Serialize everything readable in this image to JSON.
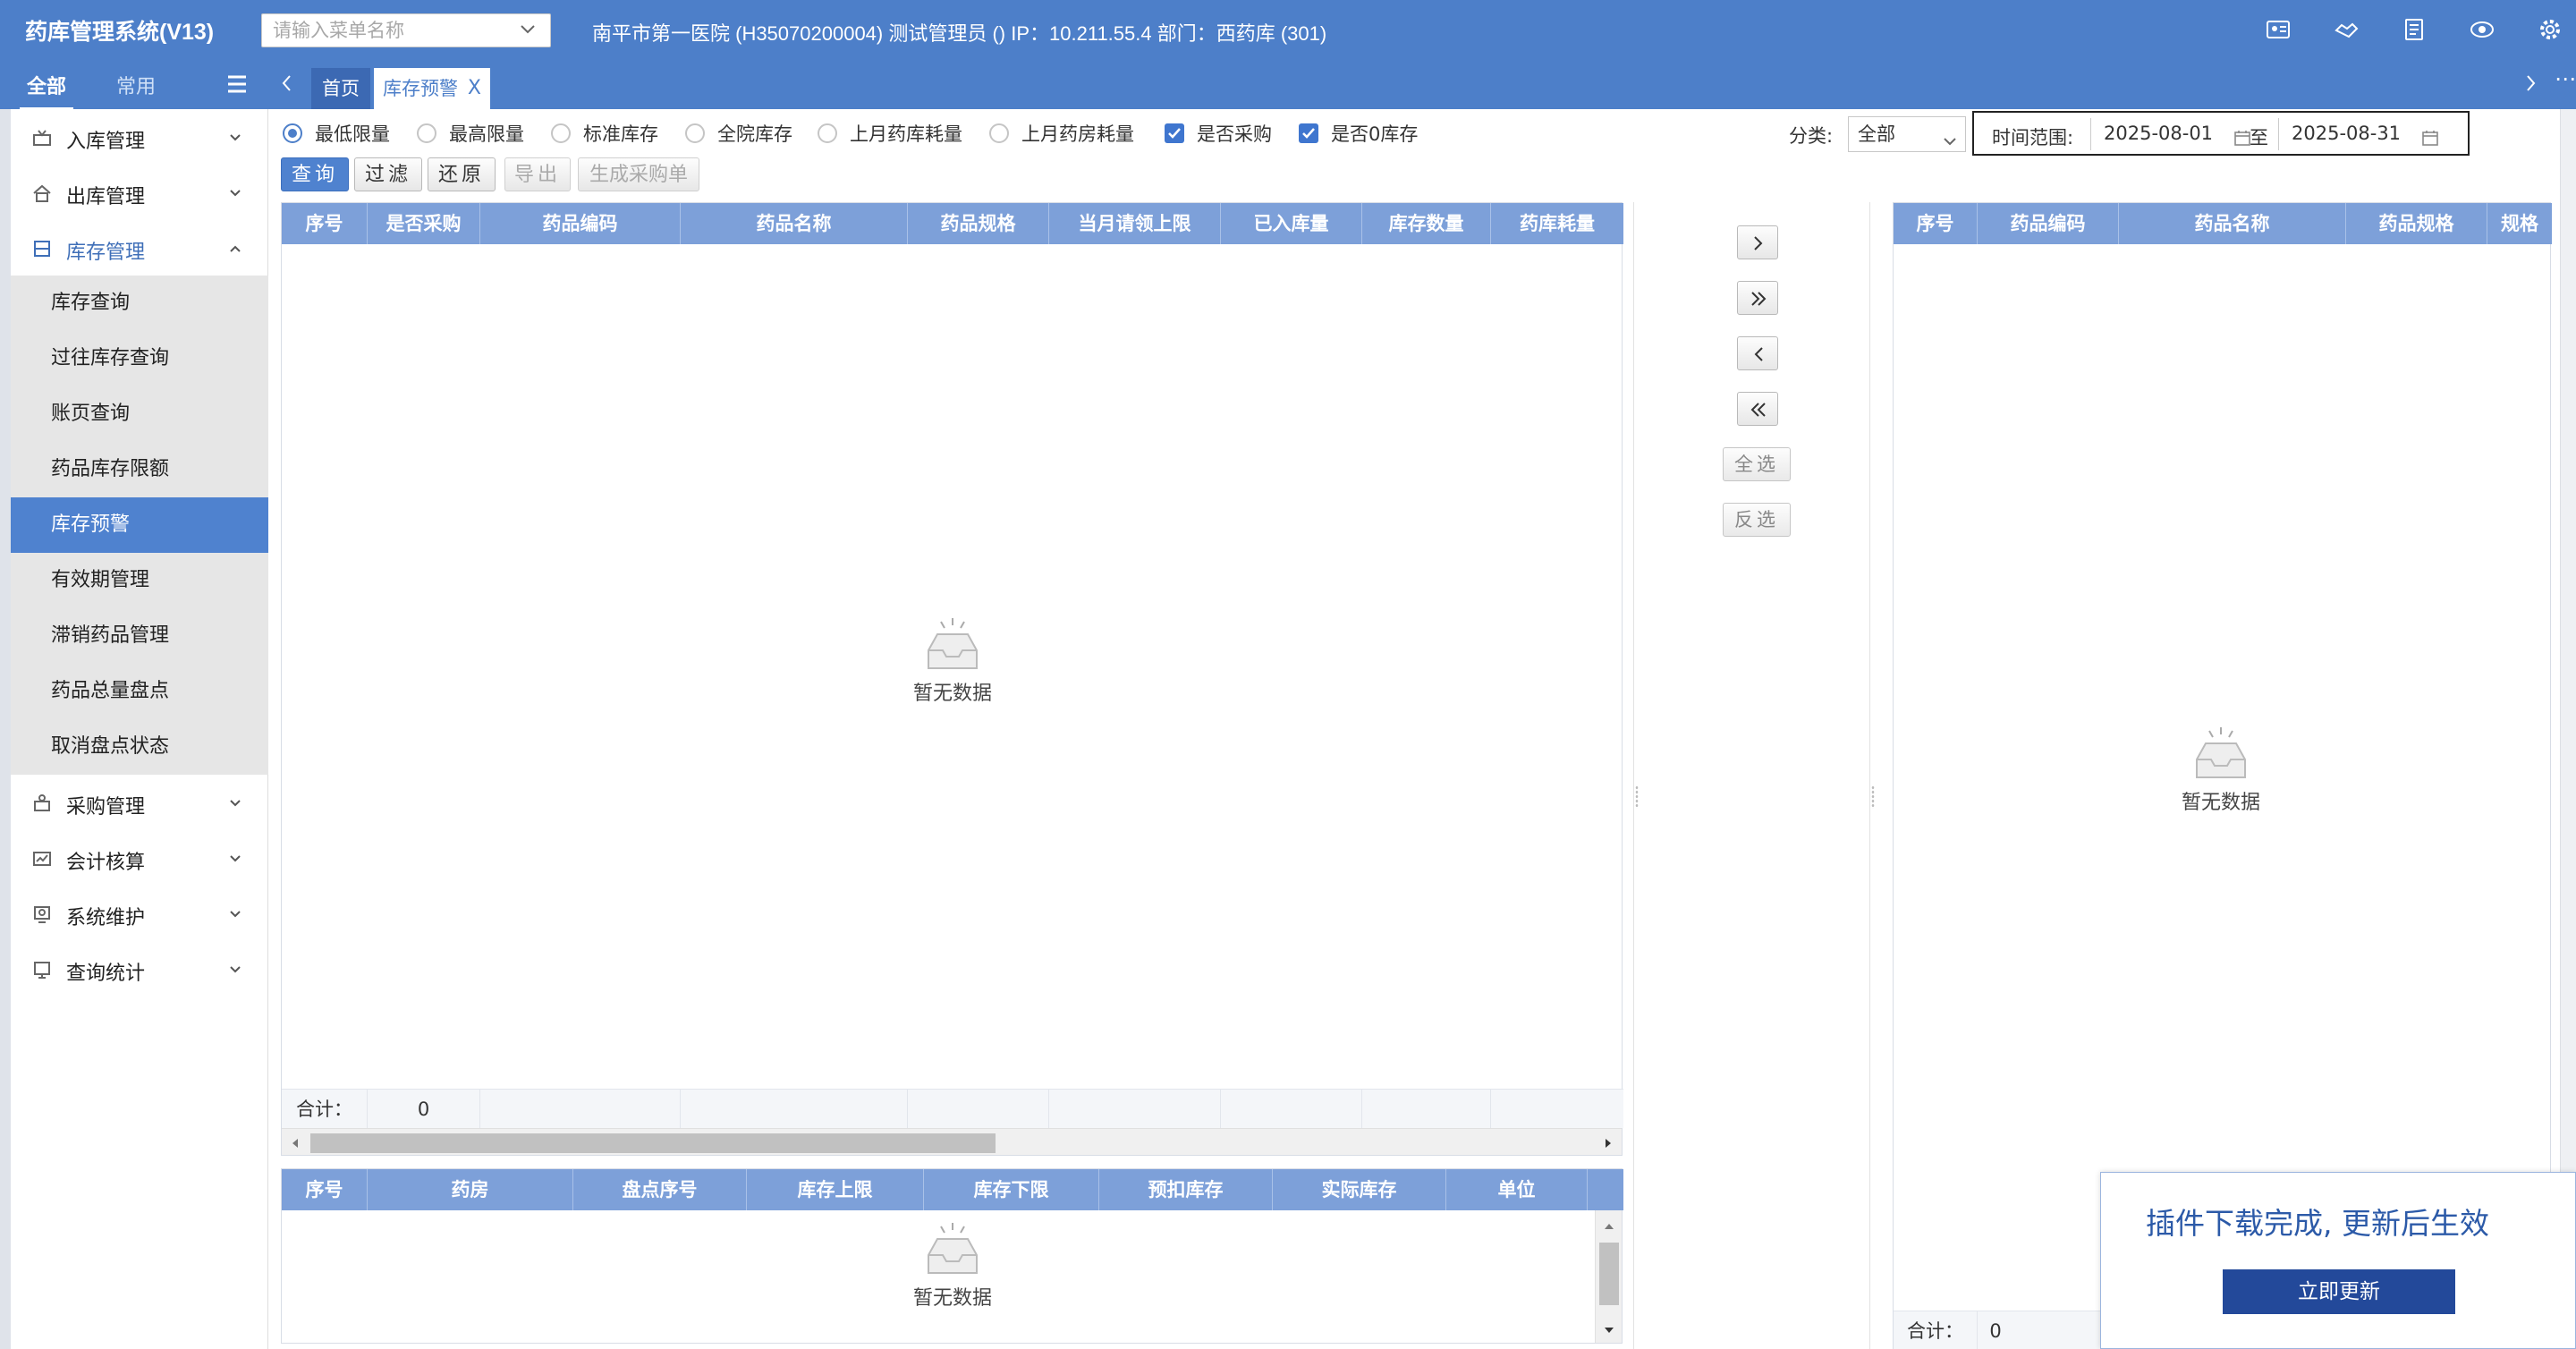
{
  "app": {
    "title": "药库管理系统(V13)",
    "info": "南平市第一医院 (H35070200004) 测试管理员 () IP：10.211.55.4 部门：西药库 (301)"
  },
  "search": {
    "placeholder": "请输入菜单名称"
  },
  "top_icons": [
    "id-card-icon",
    "handshake-icon",
    "document-icon",
    "eye-icon",
    "gear-icon"
  ],
  "sidebar": {
    "tabs": [
      "全部",
      "常用"
    ],
    "groups": [
      {
        "label": "入库管理",
        "icon": "inbox-icon"
      },
      {
        "label": "出库管理",
        "icon": "home-out-icon"
      },
      {
        "label": "库存管理",
        "icon": "stock-icon",
        "open": true,
        "items": [
          "库存查询",
          "过往库存查询",
          "账页查询",
          "药品库存限额",
          "库存预警",
          "有效期管理",
          "滞销药品管理",
          "药品总量盘点",
          "取消盘点状态"
        ],
        "active_item": "库存预警"
      },
      {
        "label": "采购管理",
        "icon": "purchase-icon"
      },
      {
        "label": "会计核算",
        "icon": "chart-icon"
      },
      {
        "label": "系统维护",
        "icon": "maintain-icon"
      },
      {
        "label": "查询统计",
        "icon": "query-icon"
      }
    ]
  },
  "tabs": [
    {
      "label": "首页"
    },
    {
      "label": "库存预警",
      "active": true,
      "close": "X"
    }
  ],
  "filters": {
    "radios": [
      "最低限量",
      "最高限量",
      "标准库存",
      "全院库存",
      "上月药库耗量",
      "上月药房耗量"
    ],
    "selected_radio": "最低限量",
    "checkboxes": [
      {
        "label": "是否采购",
        "checked": true
      },
      {
        "label": "是否0库存",
        "checked": true
      }
    ],
    "category_label": "分类:",
    "category_value": "全部",
    "time_label": "时间范围:",
    "date_from": "2025-08-01",
    "to_label": "至",
    "date_to": "2025-08-31"
  },
  "buttons": {
    "query": "查询",
    "filter": "过滤",
    "reset": "还原",
    "export": "导出",
    "generate": "生成采购单"
  },
  "main_table": {
    "columns": [
      "序号",
      "是否采购",
      "药品编码",
      "药品名称",
      "药品规格",
      "当月请领上限",
      "已入库量",
      "库存数量",
      "药库耗量"
    ],
    "empty": "暂无数据",
    "total_label": "合计：",
    "total_value": "0"
  },
  "bottom_table": {
    "columns": [
      "序号",
      "药房",
      "盘点序号",
      "库存上限",
      "库存下限",
      "预扣库存",
      "实际库存",
      "单位"
    ],
    "empty": "暂无数据"
  },
  "right_table": {
    "columns": [
      "序号",
      "药品编码",
      "药品名称",
      "药品规格",
      "规格"
    ],
    "empty": "暂无数据",
    "total_label": "合计：",
    "total_value": "0"
  },
  "transfer": {
    "select_all": "全选",
    "invert": "反选"
  },
  "notification": {
    "message": "插件下载完成, 更新后生效",
    "button": "立即更新"
  },
  "colors": {
    "primary": "#4d7fc9",
    "header": "#7da0d9",
    "active_menu": "#4f82cf",
    "notify_button": "#23499a"
  }
}
